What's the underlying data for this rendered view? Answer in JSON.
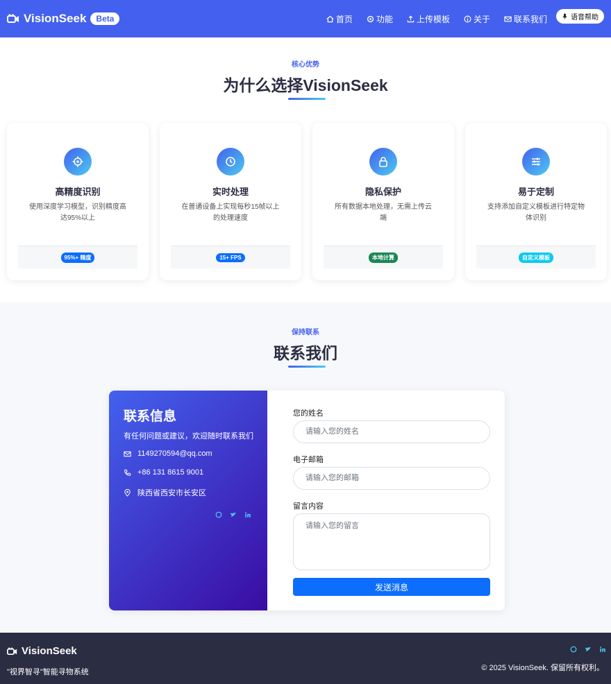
{
  "nav": {
    "brand": "VisionSeek",
    "beta": "Beta",
    "items": [
      {
        "label": "首页",
        "icon": "home-icon"
      },
      {
        "label": "功能",
        "icon": "gear-icon"
      },
      {
        "label": "上传模板",
        "icon": "upload-icon"
      },
      {
        "label": "关于",
        "icon": "info-icon"
      },
      {
        "label": "联系我们",
        "icon": "envelope-icon"
      }
    ],
    "voice": "语音帮助"
  },
  "features": {
    "eyebrow": "核心优势",
    "title": "为什么选择VisionSeek",
    "cards": [
      {
        "title": "高精度识别",
        "desc": "使用深度学习模型，识别精度高达95%以上",
        "badge": "95%+ 精度",
        "badge_color": "#0d6efd",
        "icon": "crosshair-icon"
      },
      {
        "title": "实时处理",
        "desc": "在普通设备上实现每秒15帧以上的处理速度",
        "badge": "15+ FPS",
        "badge_color": "#0d6efd",
        "icon": "clock-icon"
      },
      {
        "title": "隐私保护",
        "desc": "所有数据本地处理，无需上传云端",
        "badge": "本地计算",
        "badge_color": "#198754",
        "icon": "lock-icon"
      },
      {
        "title": "易于定制",
        "desc": "支持添加自定义模板进行特定物体识别",
        "badge": "自定义模板",
        "badge_color": "#0dcaf0",
        "icon": "sliders-icon"
      }
    ]
  },
  "contact": {
    "eyebrow": "保持联系",
    "title": "联系我们",
    "info": {
      "heading": "联系信息",
      "sub": "有任何问题或建议，欢迎随时联系我们",
      "email": "1149270594@qq.com",
      "phone": "+86 131 8615 9001",
      "address": "陕西省西安市长安区"
    },
    "form": {
      "name_label": "您的姓名",
      "name_placeholder": "请输入您的姓名",
      "email_label": "电子邮箱",
      "email_placeholder": "请输入您的邮箱",
      "message_label": "留言内容",
      "message_placeholder": "请输入您的留言",
      "submit": "发送消息"
    }
  },
  "footer": {
    "brand": "VisionSeek",
    "tagline": "\"视界智寻\"智能寻物系统",
    "copyright": "© 2025 VisionSeek. 保留所有权利。"
  },
  "colors": {
    "primary": "#4361ee",
    "accent": "#4cc9f0",
    "deep": "#3a0ca3",
    "dark": "#2b2d42"
  }
}
